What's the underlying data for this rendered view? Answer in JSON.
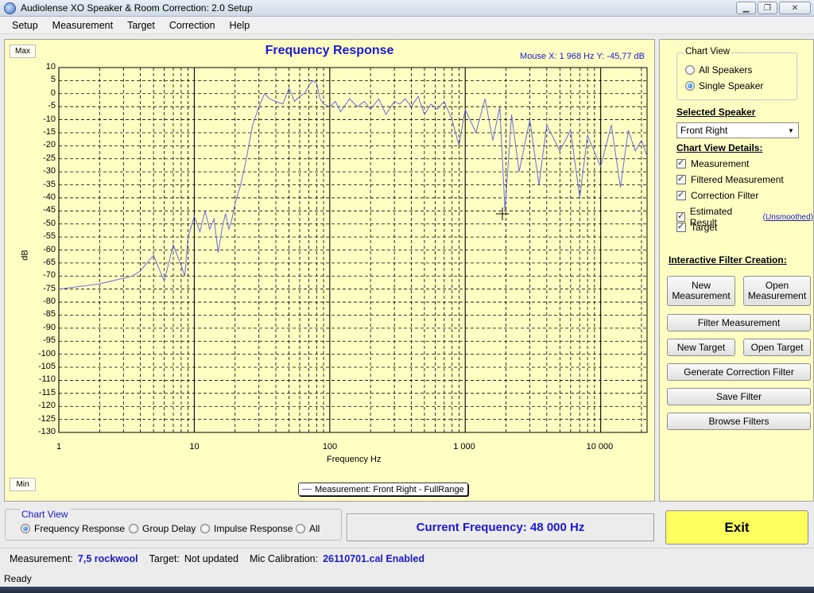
{
  "window": {
    "title": "Audiolense XO Speaker & Room Correction: 2.0 Setup"
  },
  "menu": [
    "Setup",
    "Measurement",
    "Target",
    "Correction",
    "Help"
  ],
  "chart": {
    "max_label": "Max",
    "min_label": "Min",
    "title": "Frequency Response",
    "mouse_readout": "Mouse X: 1 968 Hz   Y: -45,77 dB",
    "legend_text": "Measurement: Front Right - FullRange",
    "line_color": "#6b6bd8"
  },
  "chart_data": {
    "type": "line",
    "title": "Frequency Response",
    "xlabel": "Frequency Hz",
    "ylabel": "dB",
    "xscale": "log",
    "xlim": [
      1,
      22000
    ],
    "ylim": [
      -130,
      10
    ],
    "y_ticks": [
      10,
      5,
      0,
      -5,
      -10,
      -15,
      -20,
      -25,
      -30,
      -35,
      -40,
      -45,
      -50,
      -55,
      -60,
      -65,
      -70,
      -75,
      -80,
      -85,
      -90,
      -95,
      -100,
      -105,
      -110,
      -115,
      -120,
      -125,
      -130
    ],
    "x_tick_labels": [
      "1",
      "10",
      "100",
      "1 000",
      "10 000"
    ],
    "x_tick_values": [
      1,
      10,
      100,
      1000,
      10000
    ],
    "grid": true,
    "series": [
      {
        "name": "Measurement: Front Right - FullRange",
        "x": [
          1,
          2,
          3.5,
          4,
          5,
          6,
          7,
          8,
          8.5,
          9,
          10,
          11,
          12,
          13,
          14,
          15,
          16,
          17,
          18,
          19,
          20,
          22,
          24,
          27,
          30,
          33,
          36,
          40,
          45,
          50,
          55,
          60,
          65,
          70,
          75,
          80,
          85,
          90,
          100,
          110,
          120,
          140,
          160,
          180,
          200,
          230,
          260,
          300,
          330,
          360,
          400,
          450,
          500,
          560,
          620,
          700,
          800,
          900,
          1000,
          1200,
          1400,
          1600,
          1800,
          1968,
          2200,
          2500,
          3000,
          3500,
          4000,
          5000,
          6000,
          7000,
          8000,
          10000,
          12000,
          14000,
          16000,
          18000,
          20000,
          22000
        ],
        "y": [
          -75,
          -73,
          -70,
          -68,
          -62,
          -72,
          -58,
          -66,
          -70,
          -55,
          -47,
          -53,
          -45,
          -52,
          -48,
          -61,
          -52,
          -46,
          -52,
          -48,
          -42,
          -35,
          -26,
          -12,
          -5,
          0,
          -2,
          -3,
          -4,
          2,
          -3,
          -1,
          0,
          3,
          5,
          4,
          -2,
          -4,
          -5,
          -3,
          -7,
          -2,
          -5,
          -3,
          -6,
          -2,
          -8,
          -3,
          -4,
          -2,
          -5,
          -1,
          -8,
          -4,
          -6,
          -3,
          -10,
          -20,
          -6,
          -15,
          -2,
          -18,
          -5,
          -45,
          -8,
          -30,
          -10,
          -35,
          -12,
          -22,
          -14,
          -40,
          -16,
          -28,
          -12,
          -36,
          -14,
          -22,
          -18,
          -24
        ]
      }
    ]
  },
  "right_panel": {
    "chart_view_title": "Chart View",
    "chart_view_options": [
      "All Speakers",
      "Single Speaker"
    ],
    "chart_view_selected": "Single Speaker",
    "selected_speaker_label": "Selected Speaker",
    "selected_speaker_value": "Front Right",
    "details_label": "Chart View Details:",
    "details": [
      {
        "label": "Measurement",
        "checked": true
      },
      {
        "label": "Filtered Measurement",
        "checked": true
      },
      {
        "label": "Correction Filter",
        "checked": true
      },
      {
        "label": "Estimated Result",
        "checked": true
      },
      {
        "label": "Target",
        "checked": true
      }
    ],
    "unsmoothed_link": "(Unsmoothed)",
    "interactive_label": "Interactive Filter Creation:",
    "buttons": {
      "new_measurement": "New Measurement",
      "open_measurement": "Open Measurement",
      "filter_measurement": "Filter Measurement",
      "new_target": "New Target",
      "open_target": "Open Target",
      "generate_filter": "Generate Correction Filter",
      "save_filter": "Save Filter",
      "browse_filters": "Browse Filters"
    }
  },
  "bottom": {
    "chart_view_title": "Chart View",
    "options": [
      "Frequency Response",
      "Group Delay",
      "Impulse Response",
      "All"
    ],
    "selected": "Frequency Response",
    "current_frequency": "Current Frequency: 48 000 Hz",
    "exit_label": "Exit",
    "measurement_label": "Measurement:",
    "measurement_value": "7,5 rockwool",
    "target_label": "Target:",
    "target_value": "Not updated",
    "mic_label": "Mic Calibration:",
    "mic_value": "26110701.cal Enabled",
    "status": "Ready"
  }
}
